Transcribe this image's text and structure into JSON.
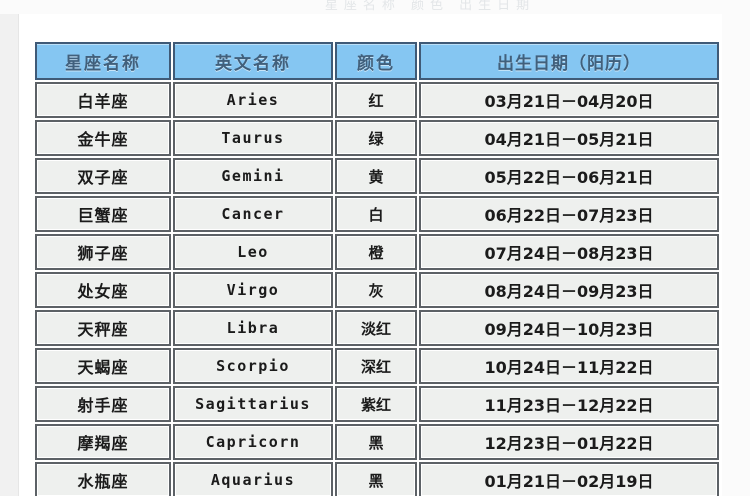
{
  "page": {
    "top_faint_text": "星座名称  颜色  出生日期"
  },
  "table": {
    "headers": {
      "name": "星座名称",
      "english": "英文名称",
      "color": "颜色",
      "birth_date": "出生日期（阳历）"
    },
    "rows": [
      {
        "name": "白羊座",
        "english": "Aries",
        "color": "红",
        "birth_date": "03月21日－04月20日"
      },
      {
        "name": "金牛座",
        "english": "Taurus",
        "color": "绿",
        "birth_date": "04月21日－05月21日"
      },
      {
        "name": "双子座",
        "english": "Gemini",
        "color": "黄",
        "birth_date": "05月22日－06月21日"
      },
      {
        "name": "巨蟹座",
        "english": "Cancer",
        "color": "白",
        "birth_date": "06月22日－07月23日"
      },
      {
        "name": "狮子座",
        "english": "Leo",
        "color": "橙",
        "birth_date": "07月24日－08月23日"
      },
      {
        "name": "处女座",
        "english": "Virgo",
        "color": "灰",
        "birth_date": "08月24日－09月23日"
      },
      {
        "name": "天秤座",
        "english": "Libra",
        "color": "淡红",
        "birth_date": "09月24日－10月23日"
      },
      {
        "name": "天蝎座",
        "english": "Scorpio",
        "color": "深红",
        "birth_date": "10月24日－11月22日"
      },
      {
        "name": "射手座",
        "english": "Sagittarius",
        "color": "紫红",
        "birth_date": "11月23日－12月22日"
      },
      {
        "name": "摩羯座",
        "english": "Capricorn",
        "color": "黑",
        "birth_date": "12月23日－01月22日"
      },
      {
        "name": "水瓶座",
        "english": "Aquarius",
        "color": "黑",
        "birth_date": "01月21日－02月19日"
      }
    ]
  },
  "colors": {
    "header_fill": "#85c6f2",
    "header_border": "#3f5a77",
    "header_text": "#41607c",
    "cell_fill": "#eef0ee",
    "cell_border": "#5c6166",
    "cell_text": "#1b1b1b",
    "page_background": "#ffffff",
    "margin_fill": "#f1f1f1"
  }
}
